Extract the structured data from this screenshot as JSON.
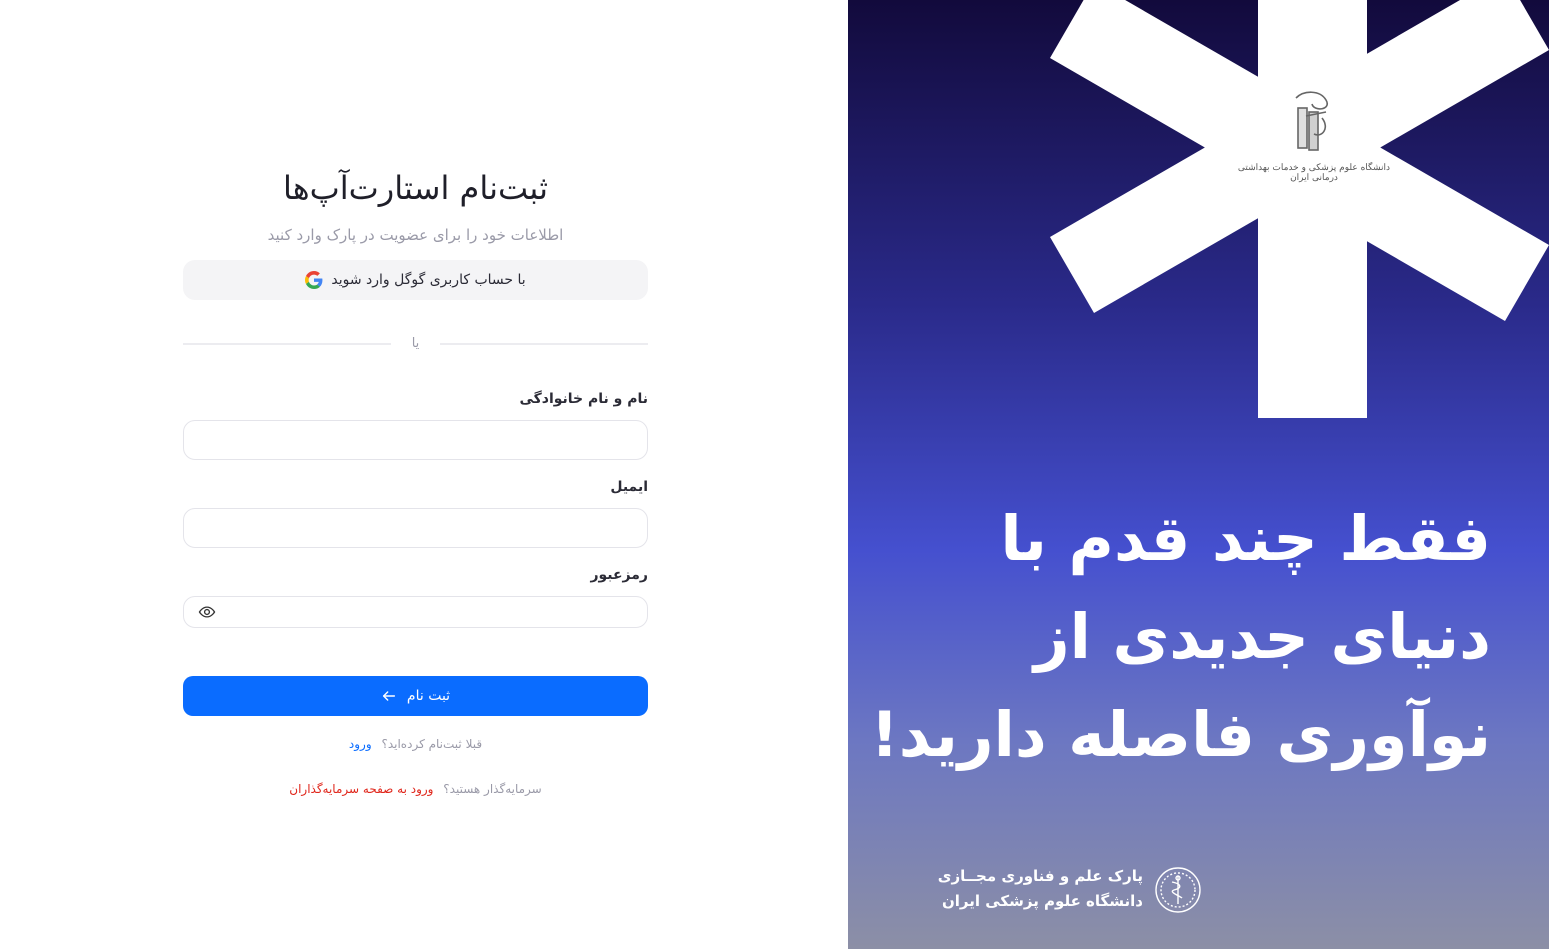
{
  "form": {
    "title": "ثبت‌نام استارت‌آپ‌ها",
    "subtitle": "اطلاعات خود را برای عضویت در پارک وارد کنید",
    "google_label": "با حساب کاربری گوگل وارد شوید",
    "divider_label": "یا",
    "fields": [
      {
        "label": "نام و نام خانوادگی",
        "value": "",
        "placeholder": ""
      },
      {
        "label": "ایمیل",
        "value": "",
        "placeholder": ""
      },
      {
        "label": "رمزعبور",
        "value": "",
        "placeholder": ""
      }
    ],
    "submit_label": "ثبت نام",
    "login_prompt": "قبلا ثبت‌نام کرده‌اید؟",
    "login_link": "ورود",
    "investor_prompt": "سرمایه‌گذار هستید؟",
    "investor_link": "ورود به صفحه سرمایه‌گذاران"
  },
  "hero": {
    "headline_lines": [
      "فقط چند قدم با",
      "دنیای جدیدی از",
      "نوآوری فاصله دارید!"
    ],
    "university_logo_text": "دانشگاه علوم پزشکی و خدمات بهداشتی درمانی ایران",
    "park_name_line1": "پارک علم و فناوری مجــازی",
    "park_name_line2": "دانشگاه علوم پزشکی ایران"
  },
  "colors": {
    "primary": "#0a6cff",
    "danger_link": "#e0261b",
    "hero_top": "#120a3c",
    "hero_mid": "#4550cf",
    "hero_bottom": "#8c8fa6"
  },
  "icons": {
    "google": "google-icon",
    "eye": "eye-icon",
    "arrow": "arrow-left-icon"
  }
}
